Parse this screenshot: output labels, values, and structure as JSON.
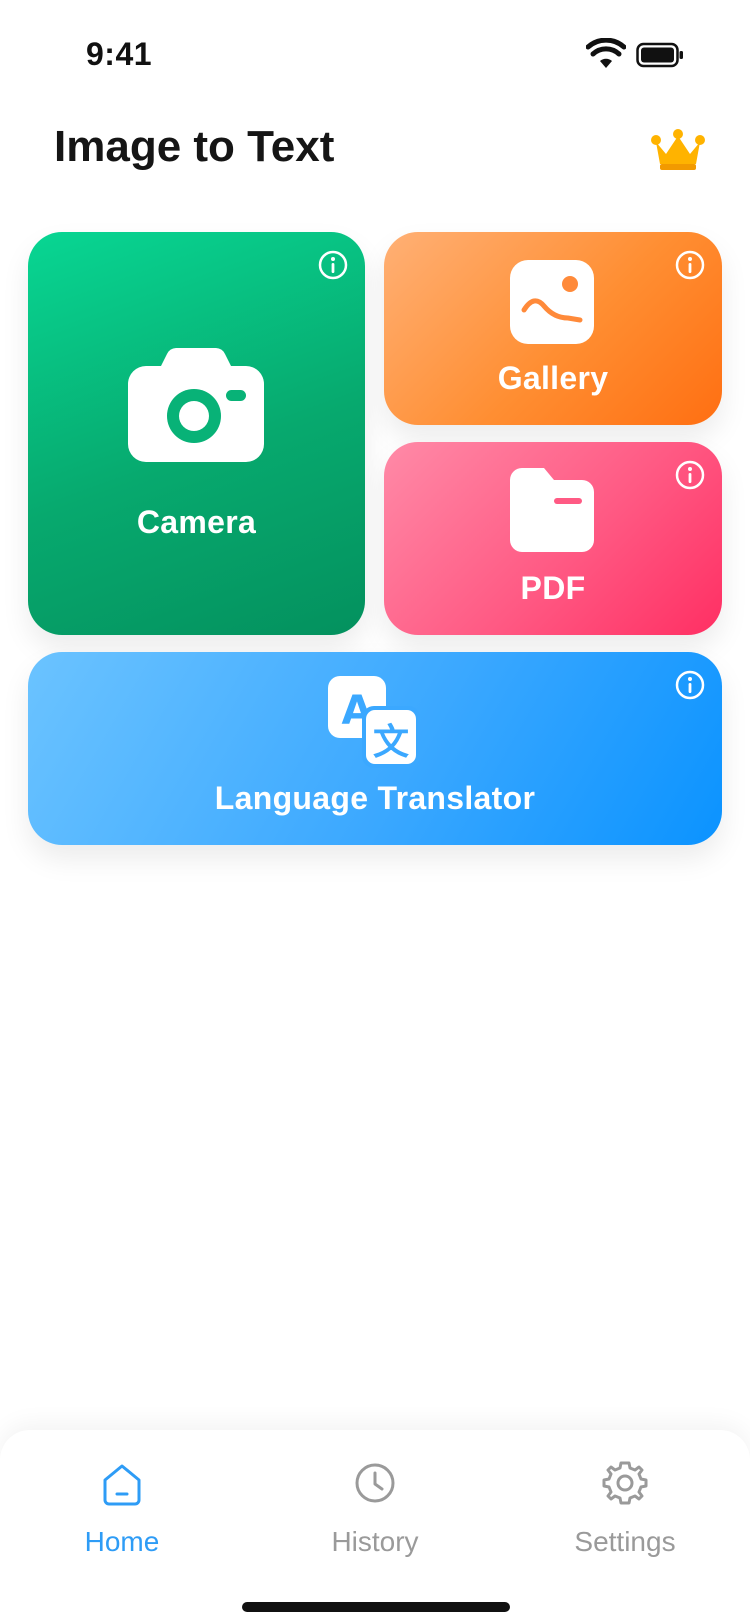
{
  "status_bar": {
    "time": "9:41"
  },
  "header": {
    "title": "Image to Text",
    "premium_icon": "crown-icon"
  },
  "cards": {
    "camera": {
      "label": "Camera",
      "icon": "camera-icon",
      "info_icon": "info-icon",
      "color": "#07a96e"
    },
    "gallery": {
      "label": "Gallery",
      "icon": "image-icon",
      "info_icon": "info-icon",
      "color": "#ff8e32"
    },
    "pdf": {
      "label": "PDF",
      "icon": "folder-icon",
      "info_icon": "info-icon",
      "color": "#ff5a84"
    },
    "translator": {
      "label": "Language Translator",
      "icon": "translate-icon",
      "info_icon": "info-icon",
      "color": "#3ba8ff"
    }
  },
  "bottom_nav": {
    "items": [
      {
        "label": "Home",
        "icon": "home-icon",
        "active": true
      },
      {
        "label": "History",
        "icon": "clock-icon",
        "active": false
      },
      {
        "label": "Settings",
        "icon": "gear-icon",
        "active": false
      }
    ],
    "active_color": "#2e9cf6",
    "inactive_color": "#9a9a9a"
  }
}
